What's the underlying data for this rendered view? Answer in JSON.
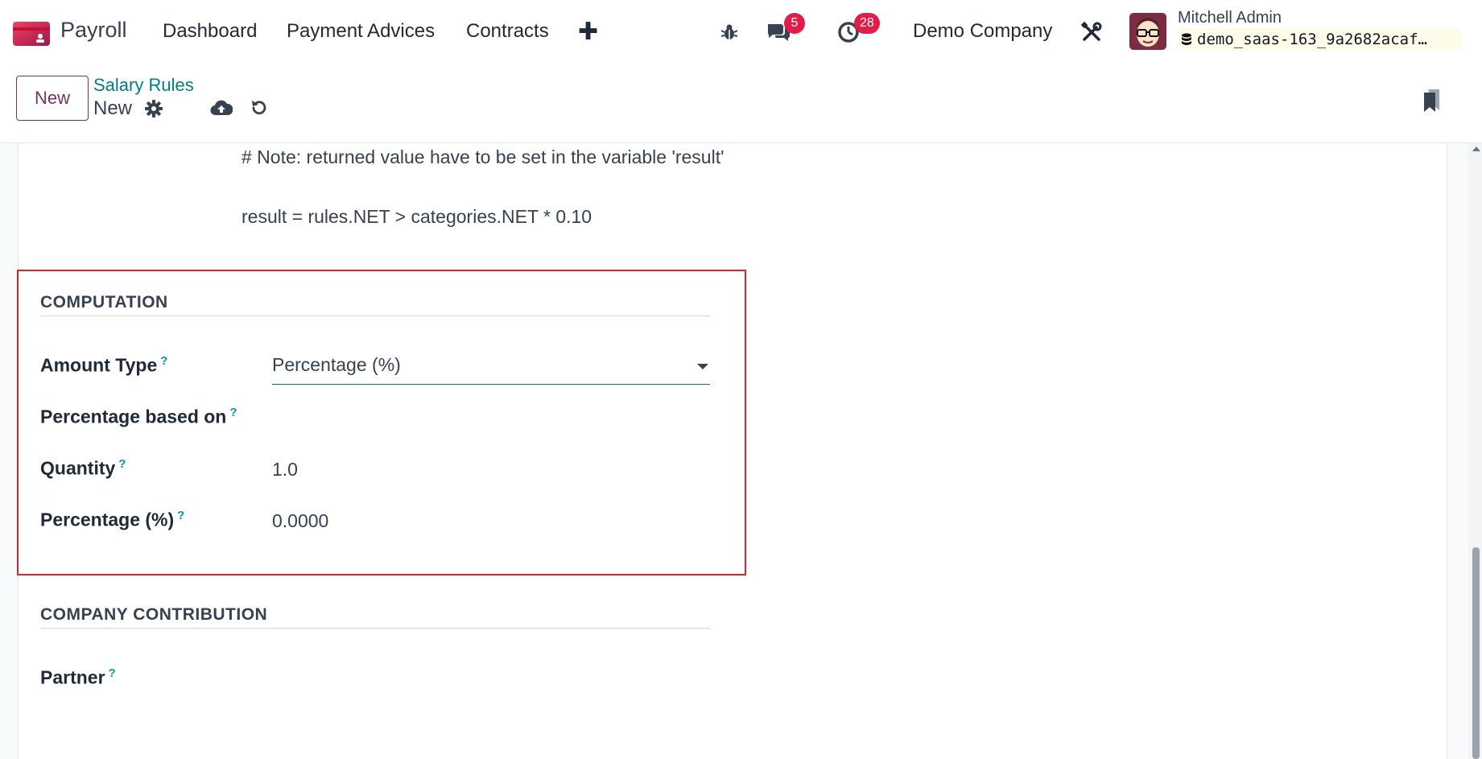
{
  "navbar": {
    "app_name": "Payroll",
    "menu": [
      "Dashboard",
      "Payment Advices",
      "Contracts"
    ],
    "add_icon": "plus-icon",
    "debug_icon": "bug-icon",
    "messages_icon": "chat-icon",
    "messages_count": "5",
    "activities_icon": "clock-icon",
    "activities_count": "28",
    "company": "Demo Company",
    "tools_icon": "wrench-screwdriver-icon",
    "user_name": "Mitchell Admin",
    "database": "demo_saas-163_9a2682acaf…"
  },
  "control_panel": {
    "new_label": "New",
    "breadcrumb_parent": "Salary Rules",
    "breadcrumb_current": "New",
    "gear_icon": "gear-icon",
    "save_icon": "cloud-upload-icon",
    "discard_icon": "undo-icon",
    "bookmark_icon": "bookmark-icon"
  },
  "code": {
    "note_line": "# Note: returned value have to be set in the variable 'result'",
    "result_line": "result = rules.NET > categories.NET * 0.10"
  },
  "computation": {
    "title": "COMPUTATION",
    "amount_type_label": "Amount Type",
    "amount_type_value": "Percentage (%)",
    "percentage_based_on_label": "Percentage based on",
    "quantity_label": "Quantity",
    "quantity_value": "1.0",
    "percentage_label": "Percentage (%)",
    "percentage_value": "0.0000",
    "help_mark": "?"
  },
  "company_contribution": {
    "title": "COMPANY CONTRIBUTION",
    "partner_label": "Partner",
    "help_mark": "?"
  },
  "colors": {
    "brand": "#71365a",
    "accent": "#017e84",
    "badge": "#e11d48",
    "highlight": "#dc2626"
  }
}
